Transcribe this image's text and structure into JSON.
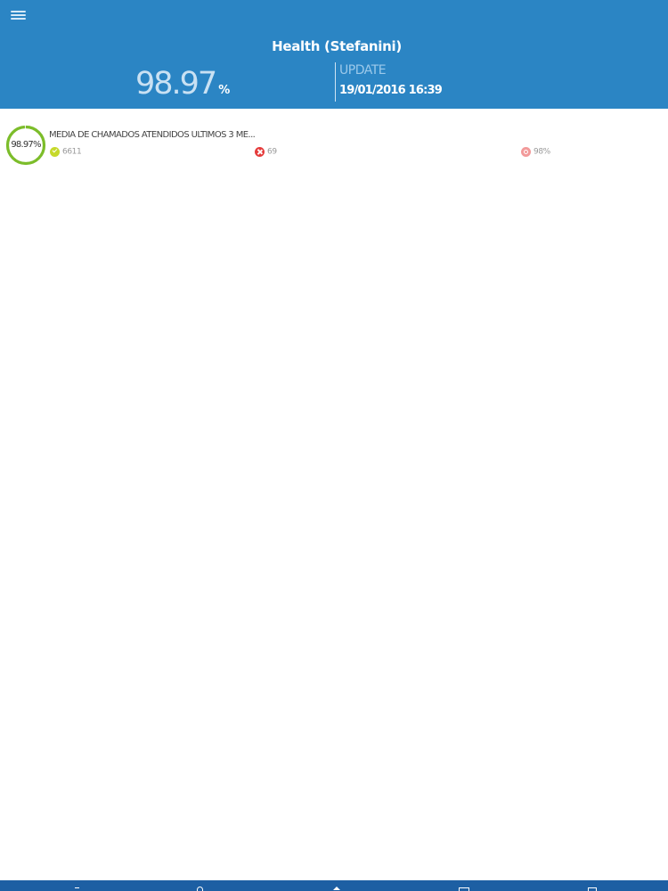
{
  "header": {
    "menu_icon": "hamburger-menu-icon",
    "title": "Health (Stefanini)",
    "kpi_value": "98.97",
    "kpi_unit": "%",
    "update_label": "UPDATE",
    "update_time": "19/01/2016 16:39"
  },
  "list": {
    "items": [
      {
        "gauge_text": "98.97%",
        "gauge_fraction": 0.9897,
        "title": "MEDIA DE CHAMADOS ATENDIDOS ULTIMOS 3 ME...",
        "ok_count": "6611",
        "fail_count": "69",
        "target": "98%"
      }
    ]
  },
  "navbar": {
    "icons": [
      "back-icon",
      "refresh-icon",
      "home-icon",
      "window-icon",
      "share-icon"
    ]
  },
  "colors": {
    "header_bg": "#2b85c4",
    "navbar_bg": "#1d5fa3",
    "gauge_ring": "#7cbd2a",
    "ok": "#c6d92b",
    "fail": "#e53b3b",
    "target": "#f29a9a"
  }
}
